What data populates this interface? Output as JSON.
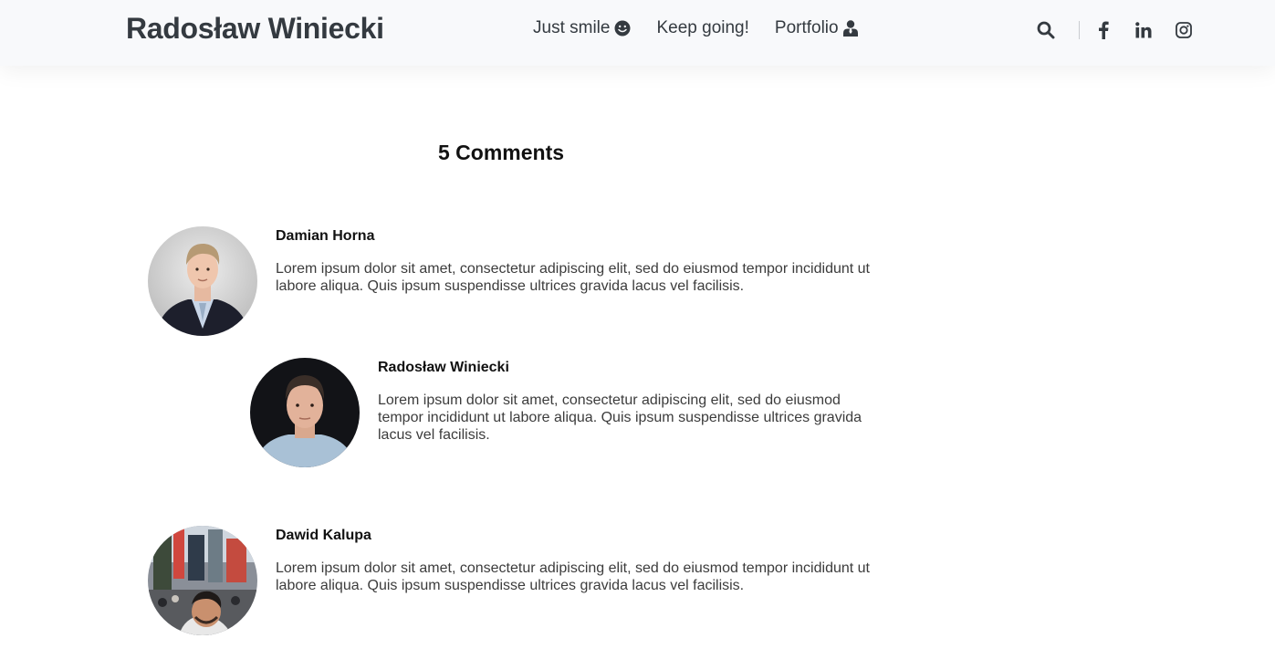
{
  "header": {
    "brand": "Radosław Winiecki",
    "nav": [
      {
        "label": "Just smile",
        "icon": "smile-icon"
      },
      {
        "label": "Keep going!",
        "icon": ""
      },
      {
        "label": "Portfolio",
        "icon": "user-tie-icon"
      }
    ],
    "icons": [
      "search-icon",
      "facebook-icon",
      "linkedin-icon",
      "instagram-icon"
    ]
  },
  "comments": {
    "title": "5 Comments",
    "items": [
      {
        "author": "Damian Horna",
        "text": "Lorem ipsum dolor sit amet, consectetur adipiscing elit, sed do eiusmod tempor incididunt ut labore aliqua. Quis ipsum suspendisse ultrices gravida lacus vel facilisis."
      },
      {
        "author": "Radosław Winiecki",
        "text": "Lorem ipsum dolor sit amet, consectetur adipiscing elit, sed do eiusmod tempor incididunt ut labore aliqua. Quis ipsum suspendisse ultrices gravida lacus vel facilisis."
      },
      {
        "author": "Dawid Kalupa",
        "text": "Lorem ipsum dolor sit amet, consectetur adipiscing elit, sed do eiusmod tempor incididunt ut labore aliqua. Quis ipsum suspendisse ultrices gravida lacus vel facilisis."
      }
    ]
  },
  "colors": {
    "navbar_bg": "#f8f9fb",
    "text_dark": "#343a40"
  }
}
